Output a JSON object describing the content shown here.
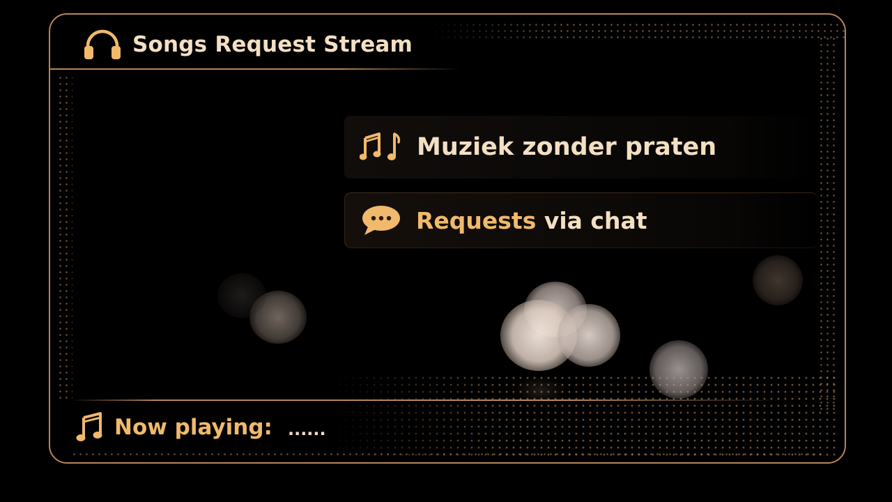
{
  "header": {
    "title": "Songs Request Stream",
    "icon": "headphones-icon"
  },
  "panels": [
    {
      "icon": "music-notes-icon",
      "text": "Muziek zonder praten"
    },
    {
      "icon": "chat-bubble-icon",
      "highlight": "Requests",
      "text": " via chat"
    }
  ],
  "now_playing": {
    "icon": "music-note-icon",
    "label": "Now playing:",
    "value": "......"
  },
  "colors": {
    "accent": "#f0b96c",
    "text": "#f3dfc2",
    "border": "#b98556",
    "background": "#000000"
  }
}
